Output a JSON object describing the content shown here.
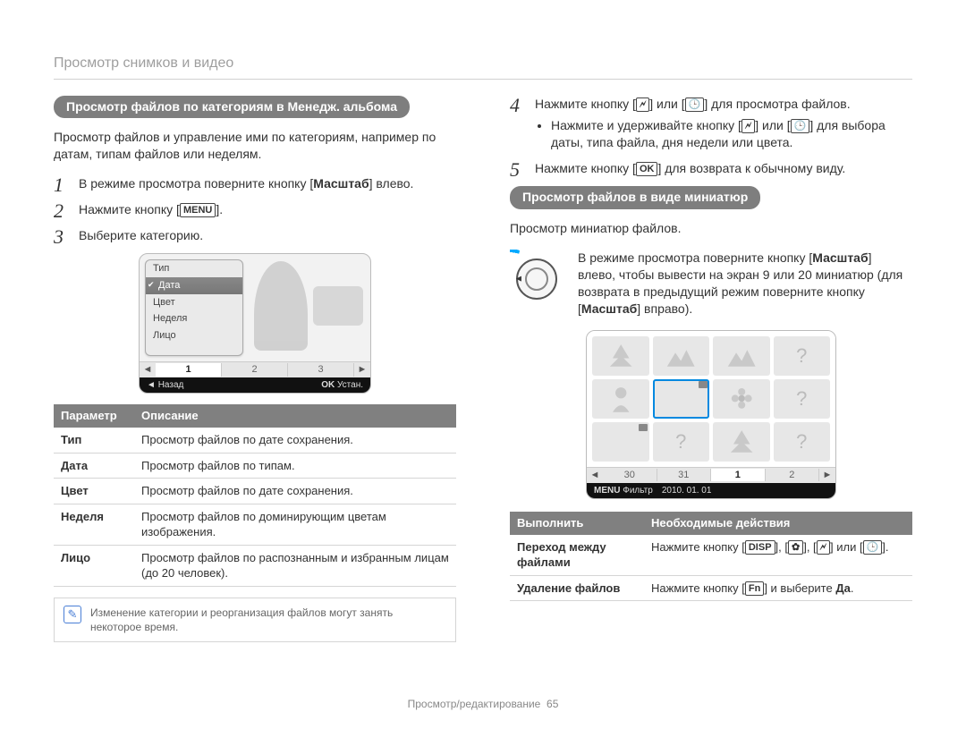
{
  "breadcrumb": "Просмотр снимков и видео",
  "left": {
    "pill": "Просмотр файлов по категориям в Менедж. альбома",
    "intro": "Просмотр файлов и управление ими по категориям, например по датам, типам файлов или неделям.",
    "steps": [
      {
        "n": "1",
        "html": "В режиме просмотра поверните кнопку [<b>Масштаб</b>] влево."
      },
      {
        "n": "2",
        "html": "Нажмите кнопку [<span class='key'>MENU</span>]."
      },
      {
        "n": "3",
        "html": "Выберите категорию."
      }
    ],
    "menu": {
      "items": [
        "Тип",
        "Дата",
        "Цвет",
        "Неделя",
        "Лицо"
      ],
      "selected": "Дата",
      "pages": [
        "1",
        "2",
        "3"
      ],
      "footer_left_icon": "◄",
      "footer_left": "Назад",
      "footer_right_key": "OK",
      "footer_right": "Устан."
    },
    "table": {
      "head": [
        "Параметр",
        "Описание"
      ],
      "rows": [
        [
          "Тип",
          "Просмотр файлов по дате сохранения."
        ],
        [
          "Дата",
          "Просмотр файлов по типам."
        ],
        [
          "Цвет",
          "Просмотр файлов по дате сохранения."
        ],
        [
          "Неделя",
          "Просмотр файлов по доминирующим цветам изображения."
        ],
        [
          "Лицо",
          "Просмотр файлов по распознанным и избранным лицам (до 20 человек)."
        ]
      ]
    },
    "note": "Изменение категории и реорганизация файлов могут занять некоторое время."
  },
  "right": {
    "steps_top": [
      {
        "n": "4",
        "html": "Нажмите кнопку [<span class='key'>🗲</span>] или [<span class='key'>🕒</span>] для просмотра файлов.",
        "sub": [
          "Нажмите и удерживайте кнопку [<span class='key'>🗲</span>] или [<span class='key'>🕒</span>] для выбора даты, типа файла, дня недели или цвета."
        ]
      },
      {
        "n": "5",
        "html": "Нажмите кнопку [<span class='key'>OK</span>] для возврата к обычному виду."
      }
    ],
    "pill": "Просмотр файлов в виде миниатюр",
    "intro": "Просмотр миниатюр файлов.",
    "dial_text": "В режиме просмотра поверните кнопку [<b>Масштаб</b>] влево, чтобы вывести на экран 9 или 20 миниатюр (для возврата в предыдущий режим поверните кнопку [<b>Масштаб</b>] вправо).",
    "dial_label": "",
    "thumbs": {
      "pages": [
        "30",
        "31",
        "1",
        "2"
      ],
      "active_page": "1",
      "footer_key": "MENU",
      "footer_left": "Фильтр",
      "footer_right": "2010. 01. 01"
    },
    "table": {
      "head": [
        "Выполнить",
        "Необходимые действия"
      ],
      "rows": [
        [
          "Переход между файлами",
          "Нажмите кнопку [<span class='key'>DISP</span>], [<span class='key'>✿</span>], [<span class='key'>🗲</span>] или [<span class='key'>🕒</span>]."
        ],
        [
          "Удаление файлов",
          "Нажмите кнопку [<span class='key'>Fn</span>] и выберите <b>Да</b>."
        ]
      ]
    }
  },
  "footer": {
    "section": "Просмотр/редактирование",
    "page": "65"
  }
}
